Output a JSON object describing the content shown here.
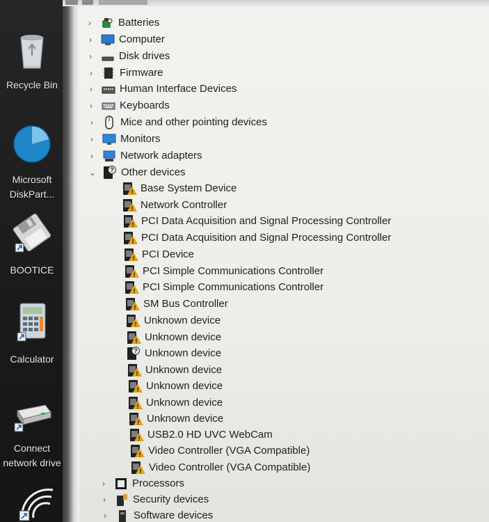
{
  "desktop": {
    "icons": [
      {
        "label": "Recycle Bin",
        "icon": "recycle-bin-icon"
      },
      {
        "label": "Microsoft\nDiskPart...",
        "icon": "diskpart-icon"
      },
      {
        "label": "BOOTICE",
        "icon": "floppy-disk-icon"
      },
      {
        "label": "Calculator",
        "icon": "calculator-icon"
      },
      {
        "label": "Connect\nnetwork drive",
        "icon": "network-drive-icon"
      }
    ]
  },
  "device_tree": {
    "categories": [
      {
        "label": "Batteries",
        "expanded": false,
        "icon": "battery-icon"
      },
      {
        "label": "Computer",
        "expanded": false,
        "icon": "computer-icon"
      },
      {
        "label": "Disk drives",
        "expanded": false,
        "icon": "disk-drive-icon"
      },
      {
        "label": "Firmware",
        "expanded": false,
        "icon": "firmware-icon"
      },
      {
        "label": "Human Interface Devices",
        "expanded": false,
        "icon": "hid-icon"
      },
      {
        "label": "Keyboards",
        "expanded": false,
        "icon": "keyboard-icon"
      },
      {
        "label": "Mice and other pointing devices",
        "expanded": false,
        "icon": "mouse-icon"
      },
      {
        "label": "Monitors",
        "expanded": false,
        "icon": "monitor-icon"
      },
      {
        "label": "Network adapters",
        "expanded": false,
        "icon": "network-adapter-icon"
      },
      {
        "label": "Other devices",
        "expanded": true,
        "icon": "other-devices-icon"
      }
    ],
    "other_devices": [
      {
        "label": "Base System Device",
        "icon": "warning-device-icon"
      },
      {
        "label": "Network Controller",
        "icon": "warning-device-icon"
      },
      {
        "label": "PCI Data Acquisition and Signal Processing Controller",
        "icon": "warning-device-icon"
      },
      {
        "label": "PCI Data Acquisition and Signal Processing Controller",
        "icon": "warning-device-icon"
      },
      {
        "label": "PCI Device",
        "icon": "warning-device-icon"
      },
      {
        "label": "PCI Simple Communications Controller",
        "icon": "warning-device-icon"
      },
      {
        "label": "PCI Simple Communications Controller",
        "icon": "warning-device-icon"
      },
      {
        "label": "SM Bus Controller",
        "icon": "warning-device-icon"
      },
      {
        "label": "Unknown device",
        "icon": "warning-device-icon"
      },
      {
        "label": "Unknown device",
        "icon": "warning-device-icon"
      },
      {
        "label": "Unknown device",
        "icon": "unknown-help-device-icon"
      },
      {
        "label": "Unknown device",
        "icon": "warning-device-icon"
      },
      {
        "label": "Unknown device",
        "icon": "warning-device-icon"
      },
      {
        "label": "Unknown device",
        "icon": "warning-device-icon"
      },
      {
        "label": "Unknown device",
        "icon": "warning-device-icon"
      },
      {
        "label": "USB2.0 HD UVC WebCam",
        "icon": "warning-device-icon"
      },
      {
        "label": "Video Controller (VGA Compatible)",
        "icon": "warning-device-icon"
      },
      {
        "label": "Video Controller (VGA Compatible)",
        "icon": "warning-device-icon"
      }
    ],
    "trailing_categories": [
      {
        "label": "Processors",
        "expanded": false,
        "icon": "processor-icon"
      },
      {
        "label": "Security devices",
        "expanded": false,
        "icon": "security-device-icon"
      },
      {
        "label": "Software devices",
        "expanded": false,
        "icon": "software-device-icon"
      }
    ]
  }
}
